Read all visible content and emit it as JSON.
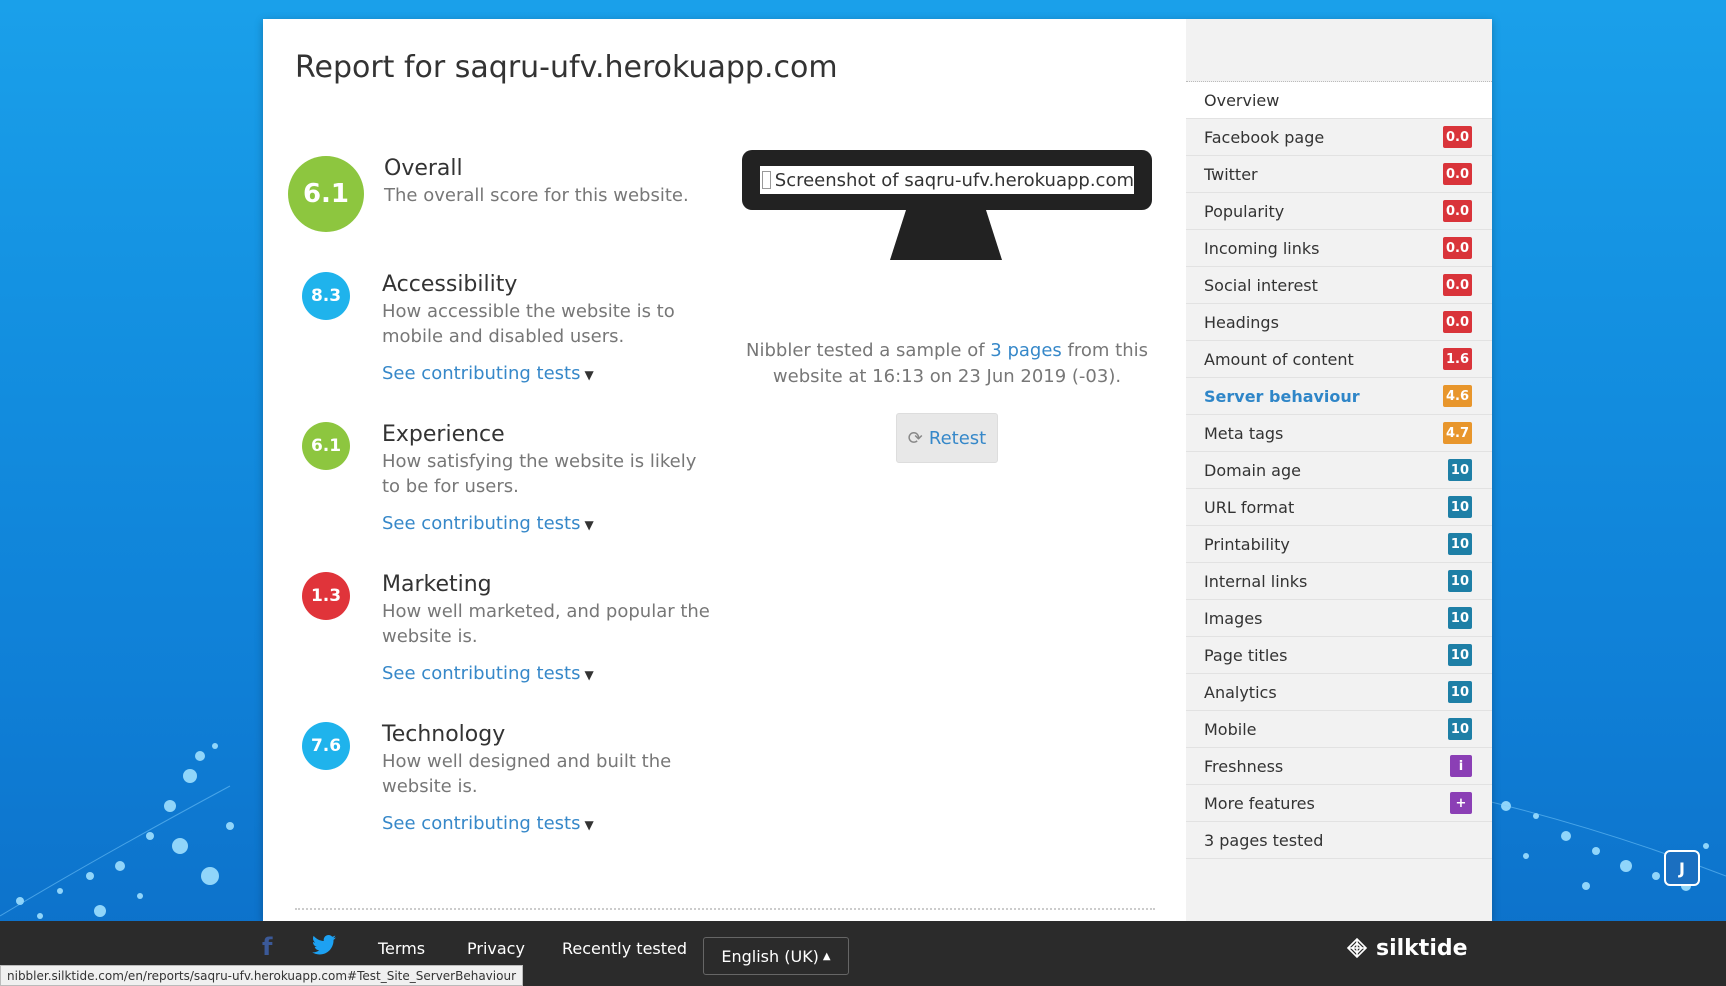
{
  "report": {
    "title": "Report for saqru-ufv.herokuapp.com",
    "screenshot_alt": "Screenshot of saqru-ufv.herokuapp.com",
    "tested_prefix": "Nibbler tested a sample of ",
    "tested_link": "3 pages",
    "tested_suffix": " from this website at 16:13 on 23 Jun 2019 (-03).",
    "retest_label": "Retest"
  },
  "scores": [
    {
      "name": "Overall",
      "value": "6.1",
      "desc": "The overall score for this website.",
      "color": "#8dc63f",
      "see": ""
    },
    {
      "name": "Accessibility",
      "value": "8.3",
      "desc": "How accessible the website is to mobile and disabled users.",
      "color": "#1fb3ec",
      "see": "See contributing tests"
    },
    {
      "name": "Experience",
      "value": "6.1",
      "desc": "How satisfying the website is likely to be for users.",
      "color": "#8dc63f",
      "see": "See contributing tests"
    },
    {
      "name": "Marketing",
      "value": "1.3",
      "desc": "How well marketed, and popular the website is.",
      "color": "#e0343a",
      "see": "See contributing tests"
    },
    {
      "name": "Technology",
      "value": "7.6",
      "desc": "How well designed and built the website is.",
      "color": "#1fb3ec",
      "see": "See contributing tests"
    }
  ],
  "sidebar": {
    "items": [
      {
        "label": "Overview",
        "badge": "",
        "badge_class": ""
      },
      {
        "label": "Facebook page",
        "badge": "0.0",
        "badge_class": "b-red"
      },
      {
        "label": "Twitter",
        "badge": "0.0",
        "badge_class": "b-red"
      },
      {
        "label": "Popularity",
        "badge": "0.0",
        "badge_class": "b-red"
      },
      {
        "label": "Incoming links",
        "badge": "0.0",
        "badge_class": "b-red"
      },
      {
        "label": "Social interest",
        "badge": "0.0",
        "badge_class": "b-red"
      },
      {
        "label": "Headings",
        "badge": "0.0",
        "badge_class": "b-red"
      },
      {
        "label": "Amount of content",
        "badge": "1.6",
        "badge_class": "b-red"
      },
      {
        "label": "Server behaviour",
        "badge": "4.6",
        "badge_class": "b-orange"
      },
      {
        "label": "Meta tags",
        "badge": "4.7",
        "badge_class": "b-orange"
      },
      {
        "label": "Domain age",
        "badge": "10",
        "badge_class": "b-teal"
      },
      {
        "label": "URL format",
        "badge": "10",
        "badge_class": "b-teal"
      },
      {
        "label": "Printability",
        "badge": "10",
        "badge_class": "b-teal"
      },
      {
        "label": "Internal links",
        "badge": "10",
        "badge_class": "b-teal"
      },
      {
        "label": "Images",
        "badge": "10",
        "badge_class": "b-teal"
      },
      {
        "label": "Page titles",
        "badge": "10",
        "badge_class": "b-teal"
      },
      {
        "label": "Analytics",
        "badge": "10",
        "badge_class": "b-teal"
      },
      {
        "label": "Mobile",
        "badge": "10",
        "badge_class": "b-teal"
      },
      {
        "label": "Freshness",
        "badge": "i",
        "badge_class": "b-purple"
      },
      {
        "label": "More features",
        "badge": "+",
        "badge_class": "b-purple"
      },
      {
        "label": "3 pages tested",
        "badge": "",
        "badge_class": ""
      }
    ]
  },
  "footer": {
    "terms": "Terms",
    "privacy": "Privacy",
    "recently_tested": "Recently tested",
    "language": "English (UK)",
    "brand": "silktide"
  },
  "statusbar": {
    "url": "nibbler.silktide.com/en/reports/saqru-ufv.herokuapp.com#Test_Site_ServerBehaviour"
  }
}
